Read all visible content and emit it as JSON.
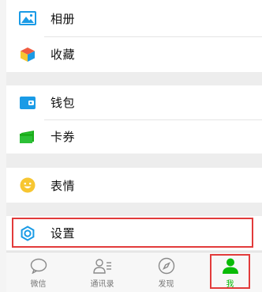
{
  "menu": {
    "group1": [
      {
        "label": "相册",
        "icon": "photo-album-icon"
      },
      {
        "label": "收藏",
        "icon": "favorites-cube-icon"
      }
    ],
    "group2": [
      {
        "label": "钱包",
        "icon": "wallet-icon"
      },
      {
        "label": "卡券",
        "icon": "card-coupon-icon"
      }
    ],
    "group3": [
      {
        "label": "表情",
        "icon": "emoji-icon"
      }
    ],
    "group4": [
      {
        "label": "设置",
        "icon": "settings-icon"
      }
    ]
  },
  "tabbar": {
    "tabs": [
      {
        "label": "微信",
        "icon": "chat-bubble-icon",
        "active": false
      },
      {
        "label": "通讯录",
        "icon": "contacts-icon",
        "active": false
      },
      {
        "label": "发现",
        "icon": "compass-icon",
        "active": false
      },
      {
        "label": "我",
        "icon": "profile-person-icon",
        "active": true
      }
    ]
  },
  "colors": {
    "accent_green": "#09bb07",
    "highlight_red": "#e23b3b",
    "album_blue": "#1a9be6",
    "wallet_blue": "#1a9be6",
    "card_green": "#1aad19",
    "emoji_yellow": "#f7c631"
  }
}
